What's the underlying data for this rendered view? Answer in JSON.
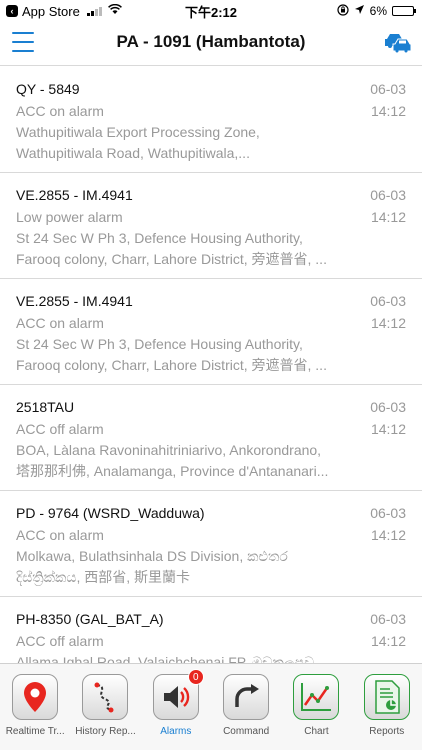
{
  "status_bar": {
    "back_app": "App Store",
    "time": "下午2:12",
    "battery_text": "6%",
    "battery_level": 0.06
  },
  "nav": {
    "title": "PA - 1091 (Hambantota)"
  },
  "alarms": [
    {
      "title": "QY - 5849",
      "type": "ACC on alarm",
      "address_line1": "Wathupitiwala Export Processing Zone,",
      "address_line2": "Wathupitiwala Road, Wathupitiwala,...",
      "date": "06-03",
      "time": "14:12"
    },
    {
      "title": "VE.2855 - IM.4941",
      "type": "Low power alarm",
      "address_line1": "St 24 Sec W Ph 3, Defence Housing Authority,",
      "address_line2": "Farooq colony, Charr, Lahore District, 旁遮普省, ...",
      "date": "06-03",
      "time": "14:12"
    },
    {
      "title": "VE.2855 - IM.4941",
      "type": "ACC on alarm",
      "address_line1": "St 24 Sec W Ph 3, Defence Housing Authority,",
      "address_line2": "Farooq colony, Charr, Lahore District, 旁遮普省, ...",
      "date": "06-03",
      "time": "14:12"
    },
    {
      "title": "2518TAU",
      "type": "ACC off alarm",
      "address_line1": "BOA, Làlana Ravoninahitriniarivo, Ankorondrano,",
      "address_line2": "塔那那利佛, Analamanga, Province d'Antananari...",
      "date": "06-03",
      "time": "14:12"
    },
    {
      "title": "PD - 9764 (WSRD_Wadduwa)",
      "type": "ACC on alarm",
      "address_line1": "Molkawa, Bulathsinhala DS Division, කළුතර",
      "address_line2": "දිස්ත්‍රික්කය, 西部省, 斯里蘭卡",
      "date": "06-03",
      "time": "14:12"
    },
    {
      "title": "PH-8350 (GAL_BAT_A)",
      "type": "ACC off alarm",
      "address_line1": "Allama Iqbal Road, Valaichchenai FP, මඩකලපුව",
      "address_line2": "",
      "date": "06-03",
      "time": "14:12"
    }
  ],
  "tabs": [
    {
      "label": "Realtime Tr...",
      "icon": "location-pin-icon"
    },
    {
      "label": "History Rep...",
      "icon": "route-icon"
    },
    {
      "label": "Alarms",
      "icon": "speaker-alarm-icon",
      "badge": "0"
    },
    {
      "label": "Command",
      "icon": "command-arrow-icon"
    },
    {
      "label": "Chart",
      "icon": "line-chart-icon"
    },
    {
      "label": "Reports",
      "icon": "report-document-icon"
    }
  ],
  "colors": {
    "accent": "#1a7fd1",
    "badge": "#e8261f",
    "muted_text": "#999999"
  }
}
